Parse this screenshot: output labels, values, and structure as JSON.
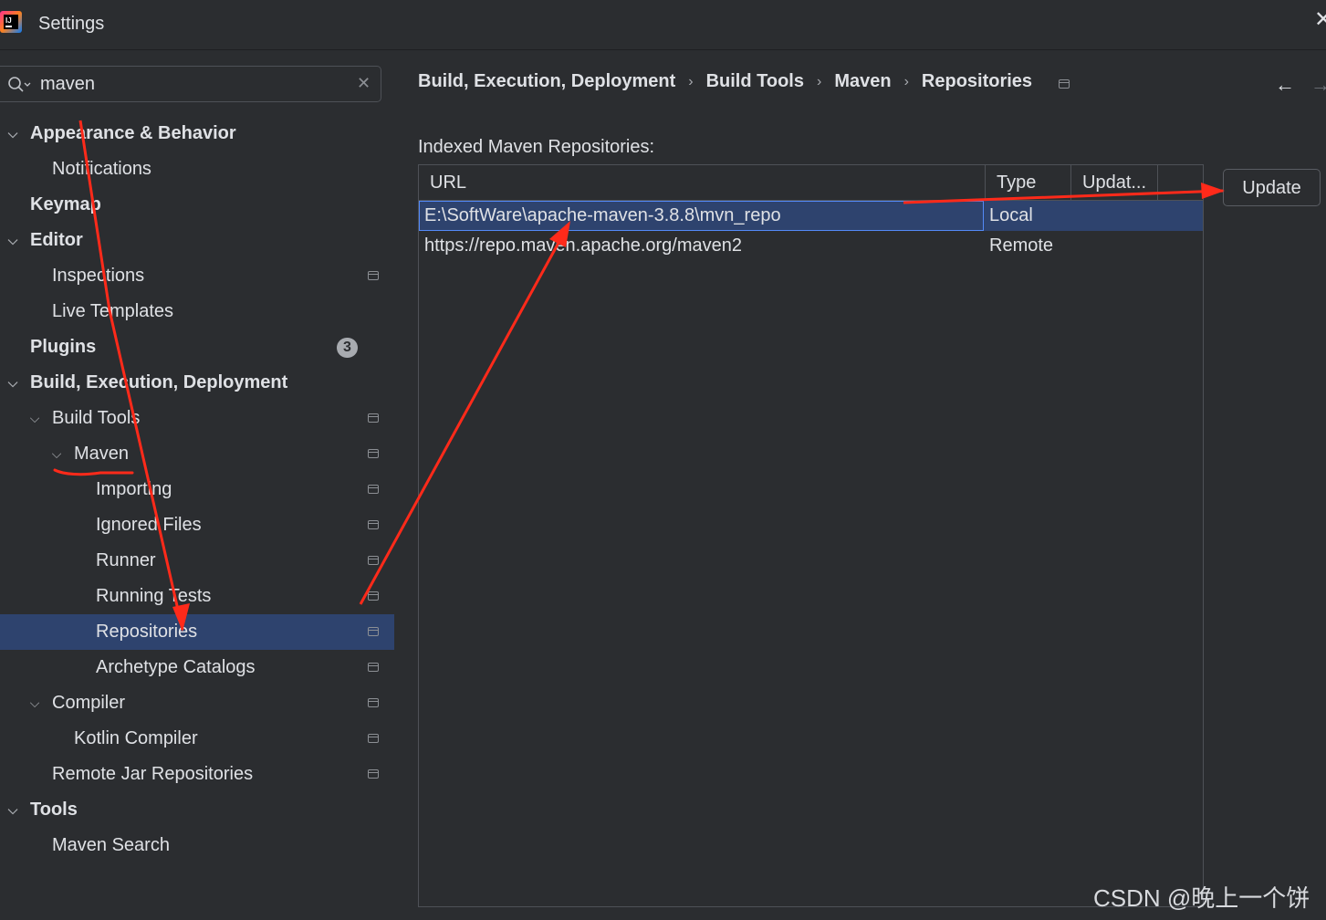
{
  "window": {
    "title": "Settings"
  },
  "search": {
    "value": "maven"
  },
  "tree": {
    "appearance": "Appearance & Behavior",
    "notifications": "Notifications",
    "keymap": "Keymap",
    "editor": "Editor",
    "inspections": "Inspections",
    "live_templates": "Live Templates",
    "plugins": "Plugins",
    "plugins_badge": "3",
    "build": "Build, Execution, Deployment",
    "build_tools": "Build Tools",
    "maven": "Maven",
    "importing": "Importing",
    "ignored_files": "Ignored Files",
    "runner": "Runner",
    "running_tests": "Running Tests",
    "repositories": "Repositories",
    "archetype_catalogs": "Archetype Catalogs",
    "compiler": "Compiler",
    "kotlin_compiler": "Kotlin Compiler",
    "remote_jar": "Remote Jar Repositories",
    "tools": "Tools",
    "maven_search": "Maven Search"
  },
  "breadcrumb": [
    "Build, Execution, Deployment",
    "Build Tools",
    "Maven",
    "Repositories"
  ],
  "main": {
    "section_label": "Indexed Maven Repositories:",
    "columns": [
      "URL",
      "Type",
      "Updat..."
    ],
    "rows": [
      {
        "url": "E:\\SoftWare\\apache-maven-3.8.8\\mvn_repo",
        "type": "Local",
        "updated": ""
      },
      {
        "url": "https://repo.maven.apache.org/maven2",
        "type": "Remote",
        "updated": ""
      }
    ],
    "update_button": "Update"
  },
  "watermark": "CSDN @晚上一个饼",
  "colors": {
    "background": "#2b2d30",
    "selection": "#2e436e",
    "annotation": "#ff2a1a"
  }
}
